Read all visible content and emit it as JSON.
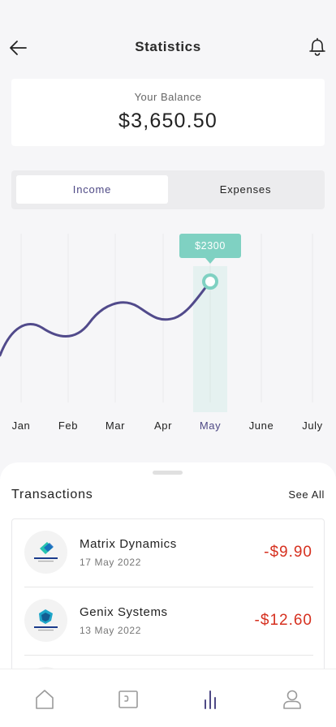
{
  "header": {
    "title": "Statistics",
    "back_icon": "arrow-left-icon",
    "notification_icon": "bell-icon"
  },
  "balance": {
    "label": "Your Balance",
    "value": "$3,650.50"
  },
  "tabs": [
    {
      "label": "Income",
      "active": true
    },
    {
      "label": "Expenses",
      "active": false
    }
  ],
  "chart_data": {
    "type": "line",
    "categories": [
      "Jan",
      "Feb",
      "Mar",
      "Apr",
      "May",
      "June",
      "July"
    ],
    "highlighted": {
      "category": "May",
      "label": "$2300"
    },
    "colors": {
      "line": "#514a8b",
      "highlight": "#7fd1c2",
      "active_label": "#4e4985"
    },
    "grid": true
  },
  "transactions": {
    "title": "Transactions",
    "see_all": "See All",
    "items": [
      {
        "company": "Matrix Dynamics",
        "date": "17 May 2022",
        "amount": "-$9.90",
        "logo_icon": "company-logo-icon"
      },
      {
        "company": "Genix Systems",
        "date": "13 May 2022",
        "amount": "-$12.60",
        "logo_icon": "company-logo-icon"
      }
    ]
  },
  "nav": [
    {
      "name": "home-icon",
      "active": false
    },
    {
      "name": "wallet-icon",
      "active": false
    },
    {
      "name": "statistics-icon",
      "active": true
    },
    {
      "name": "profile-icon",
      "active": false
    }
  ]
}
